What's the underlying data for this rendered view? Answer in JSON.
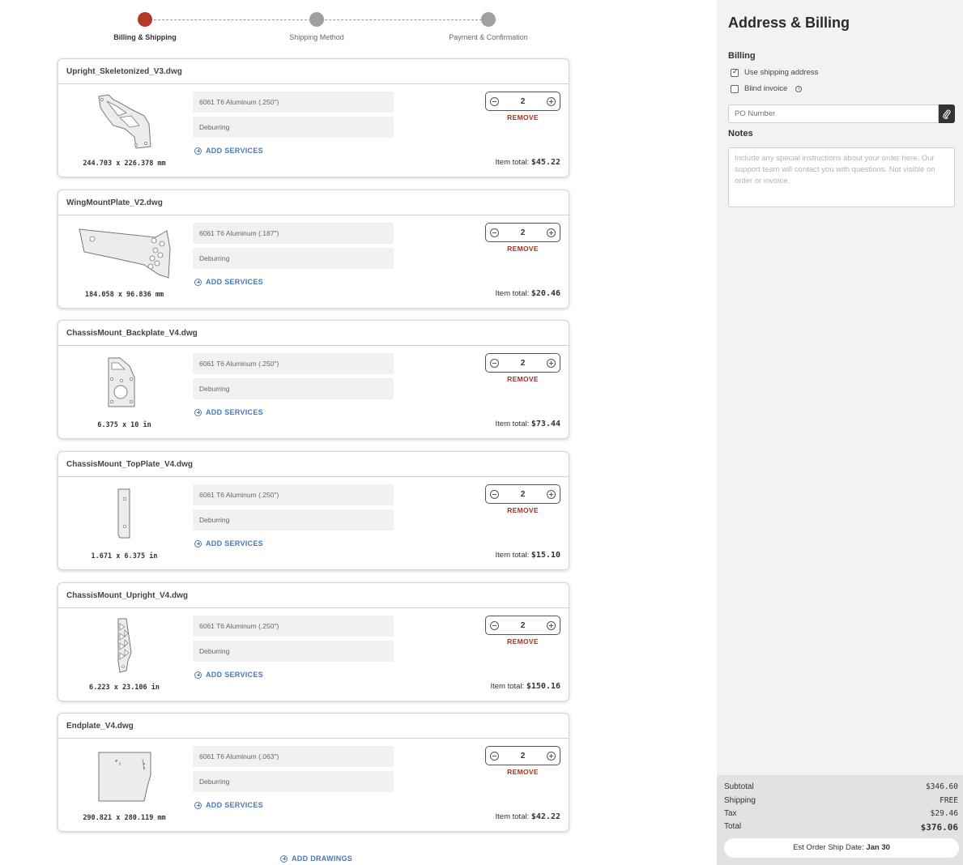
{
  "stepper": {
    "steps": [
      {
        "label": "Billing & Shipping"
      },
      {
        "label": "Shipping Method"
      },
      {
        "label": "Payment & Confirmation"
      }
    ]
  },
  "parts": [
    {
      "filename": "Upright_Skeletonized_V3.dwg",
      "material": "6061 T6 Aluminum (.250\")",
      "service": "Deburring",
      "add_services": "ADD SERVICES",
      "quantity": "2",
      "remove": "REMOVE",
      "dims": "244.703 x 226.378 mm",
      "total_label": "Item total:",
      "total": "$45.22"
    },
    {
      "filename": "WingMountPlate_V2.dwg",
      "material": "6061 T6 Aluminum (.187\")",
      "service": "Deburring",
      "add_services": "ADD SERVICES",
      "quantity": "2",
      "remove": "REMOVE",
      "dims": "184.058 x 96.836 mm",
      "total_label": "Item total:",
      "total": "$20.46"
    },
    {
      "filename": "ChassisMount_Backplate_V4.dwg",
      "material": "6061 T6 Aluminum (.250\")",
      "service": "Deburring",
      "add_services": "ADD SERVICES",
      "quantity": "2",
      "remove": "REMOVE",
      "dims": "6.375 x 10 in",
      "total_label": "Item total:",
      "total": "$73.44"
    },
    {
      "filename": "ChassisMount_TopPlate_V4.dwg",
      "material": "6061 T6 Aluminum (.250\")",
      "service": "Deburring",
      "add_services": "ADD SERVICES",
      "quantity": "2",
      "remove": "REMOVE",
      "dims": "1.671 x 6.375 in",
      "total_label": "Item total:",
      "total": "$15.10"
    },
    {
      "filename": "ChassisMount_Upright_V4.dwg",
      "material": "6061 T6 Aluminum (.250\")",
      "service": "Deburring",
      "add_services": "ADD SERVICES",
      "quantity": "2",
      "remove": "REMOVE",
      "dims": "6.223 x 23.106 in",
      "total_label": "Item total:",
      "total": "$150.16"
    },
    {
      "filename": "Endplate_V4.dwg",
      "material": "6061 T6 Aluminum (.063\")",
      "service": "Deburring",
      "add_services": "ADD SERVICES",
      "quantity": "2",
      "remove": "REMOVE",
      "dims": "290.821 x 280.119 mm",
      "total_label": "Item total:",
      "total": "$42.22"
    }
  ],
  "add_drawings": "ADD DRAWINGS",
  "panel": {
    "title": "Address & Billing",
    "billing_heading": "Billing",
    "use_shipping_label": "Use shipping address",
    "use_shipping_checked": true,
    "blind_invoice_label": "Blind invoice",
    "blind_invoice_checked": false,
    "po_placeholder": "PO Number",
    "notes_heading": "Notes",
    "notes_placeholder": "Include any special instructions about your order here. Our support team will contact you with questions. Not visible on order or invoice."
  },
  "summary": {
    "subtotal_label": "Subtotal",
    "subtotal": "$346.60",
    "shipping_label": "Shipping",
    "shipping": "FREE",
    "tax_label": "Tax",
    "tax": "$29.46",
    "total_label": "Total",
    "total": "$376.06",
    "ship_date_label": "Est Order Ship Date:",
    "ship_date": "Jan 30"
  }
}
